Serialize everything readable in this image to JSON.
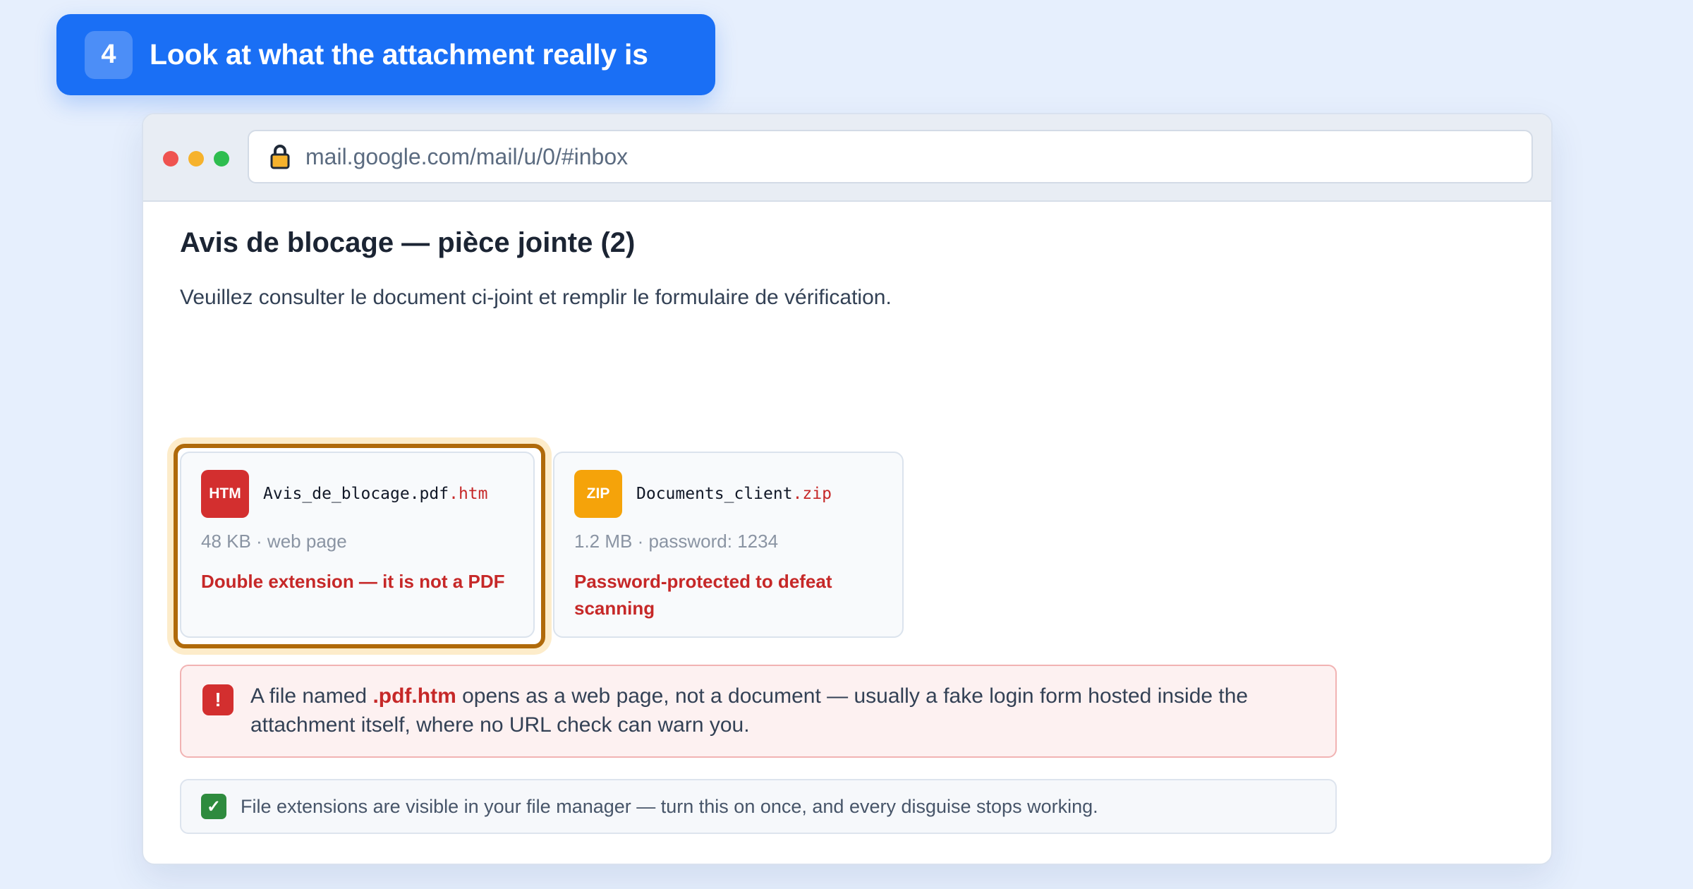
{
  "step": {
    "number": "4",
    "title": "Look at what the attachment really is"
  },
  "browser": {
    "url": "mail.google.com/mail/u/0/#inbox",
    "lock_icon": "lock-icon",
    "colors": {
      "red": "#ef5350",
      "yellow": "#f6b22c",
      "green": "#2ebd4f"
    }
  },
  "email": {
    "subject": "Avis de blocage — pièce jointe (2)",
    "body": "Veuillez consulter le document ci-joint et remplir le formulaire de vérification."
  },
  "attachments": [
    {
      "icon_label": "HTM",
      "name_base": "Avis_de_blocage.pdf",
      "name_ext": ".htm",
      "meta": "48 KB · web page",
      "warning": "Double extension — it is not a PDF",
      "highlighted": true,
      "icon_color": "#d32f2f"
    },
    {
      "icon_label": "ZIP",
      "name_base": "Documents_client",
      "name_ext": ".zip",
      "meta": "1.2 MB · password: 1234",
      "warning": "Password-protected to defeat scanning",
      "highlighted": false,
      "icon_color": "#f5a30a"
    }
  ],
  "alert": {
    "icon": "!",
    "text_before": "A file named ",
    "code": ".pdf.htm",
    "text_after": " opens as a web page, not a document — usually a fake login form hosted inside the attachment itself, where no URL check can warn you."
  },
  "tip": {
    "icon": "✓",
    "text": "File extensions are visible in your file manager — turn this on once, and every disguise stops working."
  }
}
